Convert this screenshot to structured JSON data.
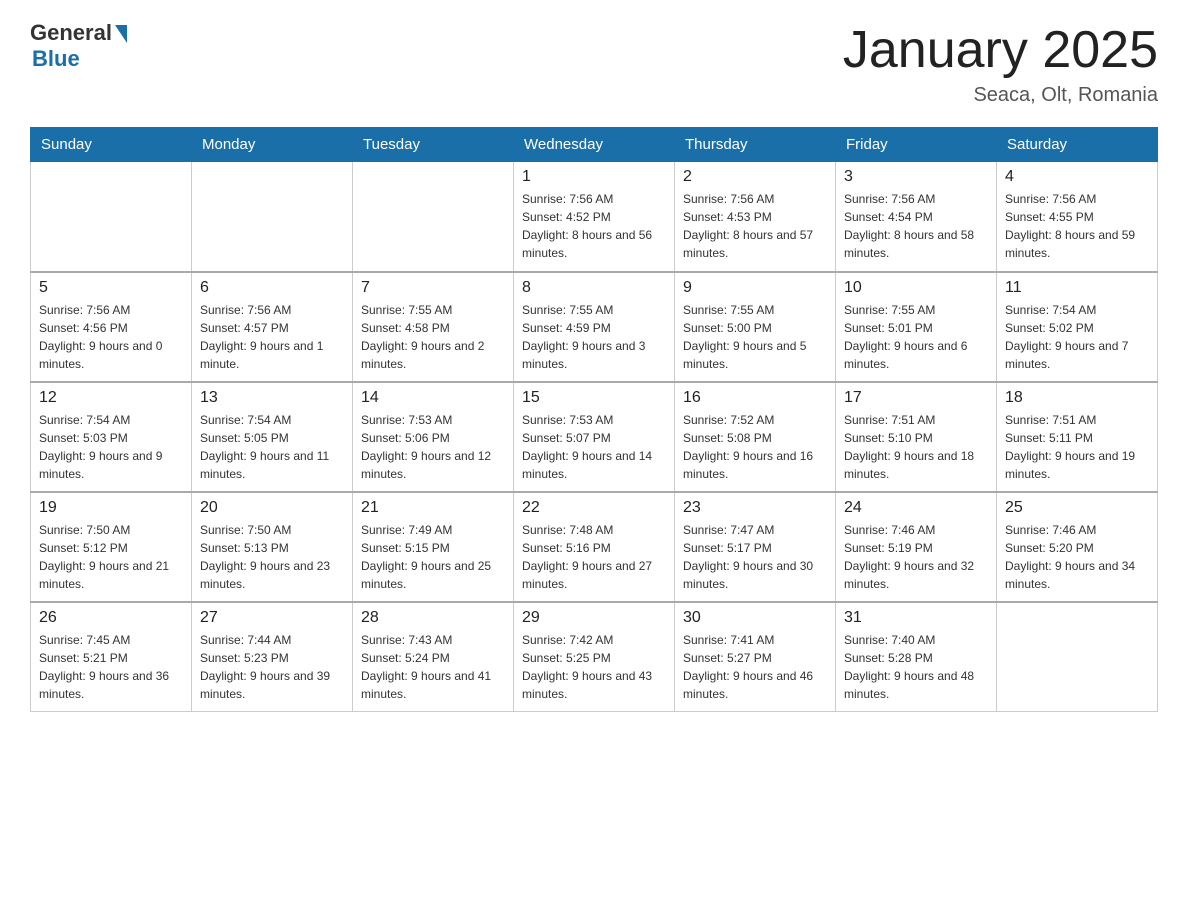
{
  "header": {
    "logo": {
      "general": "General",
      "blue": "Blue"
    },
    "title": "January 2025",
    "location": "Seaca, Olt, Romania"
  },
  "days_of_week": [
    "Sunday",
    "Monday",
    "Tuesday",
    "Wednesday",
    "Thursday",
    "Friday",
    "Saturday"
  ],
  "weeks": [
    [
      {
        "day": "",
        "sunrise": "",
        "sunset": "",
        "daylight": ""
      },
      {
        "day": "",
        "sunrise": "",
        "sunset": "",
        "daylight": ""
      },
      {
        "day": "",
        "sunrise": "",
        "sunset": "",
        "daylight": ""
      },
      {
        "day": "1",
        "sunrise": "Sunrise: 7:56 AM",
        "sunset": "Sunset: 4:52 PM",
        "daylight": "Daylight: 8 hours and 56 minutes."
      },
      {
        "day": "2",
        "sunrise": "Sunrise: 7:56 AM",
        "sunset": "Sunset: 4:53 PM",
        "daylight": "Daylight: 8 hours and 57 minutes."
      },
      {
        "day": "3",
        "sunrise": "Sunrise: 7:56 AM",
        "sunset": "Sunset: 4:54 PM",
        "daylight": "Daylight: 8 hours and 58 minutes."
      },
      {
        "day": "4",
        "sunrise": "Sunrise: 7:56 AM",
        "sunset": "Sunset: 4:55 PM",
        "daylight": "Daylight: 8 hours and 59 minutes."
      }
    ],
    [
      {
        "day": "5",
        "sunrise": "Sunrise: 7:56 AM",
        "sunset": "Sunset: 4:56 PM",
        "daylight": "Daylight: 9 hours and 0 minutes."
      },
      {
        "day": "6",
        "sunrise": "Sunrise: 7:56 AM",
        "sunset": "Sunset: 4:57 PM",
        "daylight": "Daylight: 9 hours and 1 minute."
      },
      {
        "day": "7",
        "sunrise": "Sunrise: 7:55 AM",
        "sunset": "Sunset: 4:58 PM",
        "daylight": "Daylight: 9 hours and 2 minutes."
      },
      {
        "day": "8",
        "sunrise": "Sunrise: 7:55 AM",
        "sunset": "Sunset: 4:59 PM",
        "daylight": "Daylight: 9 hours and 3 minutes."
      },
      {
        "day": "9",
        "sunrise": "Sunrise: 7:55 AM",
        "sunset": "Sunset: 5:00 PM",
        "daylight": "Daylight: 9 hours and 5 minutes."
      },
      {
        "day": "10",
        "sunrise": "Sunrise: 7:55 AM",
        "sunset": "Sunset: 5:01 PM",
        "daylight": "Daylight: 9 hours and 6 minutes."
      },
      {
        "day": "11",
        "sunrise": "Sunrise: 7:54 AM",
        "sunset": "Sunset: 5:02 PM",
        "daylight": "Daylight: 9 hours and 7 minutes."
      }
    ],
    [
      {
        "day": "12",
        "sunrise": "Sunrise: 7:54 AM",
        "sunset": "Sunset: 5:03 PM",
        "daylight": "Daylight: 9 hours and 9 minutes."
      },
      {
        "day": "13",
        "sunrise": "Sunrise: 7:54 AM",
        "sunset": "Sunset: 5:05 PM",
        "daylight": "Daylight: 9 hours and 11 minutes."
      },
      {
        "day": "14",
        "sunrise": "Sunrise: 7:53 AM",
        "sunset": "Sunset: 5:06 PM",
        "daylight": "Daylight: 9 hours and 12 minutes."
      },
      {
        "day": "15",
        "sunrise": "Sunrise: 7:53 AM",
        "sunset": "Sunset: 5:07 PM",
        "daylight": "Daylight: 9 hours and 14 minutes."
      },
      {
        "day": "16",
        "sunrise": "Sunrise: 7:52 AM",
        "sunset": "Sunset: 5:08 PM",
        "daylight": "Daylight: 9 hours and 16 minutes."
      },
      {
        "day": "17",
        "sunrise": "Sunrise: 7:51 AM",
        "sunset": "Sunset: 5:10 PM",
        "daylight": "Daylight: 9 hours and 18 minutes."
      },
      {
        "day": "18",
        "sunrise": "Sunrise: 7:51 AM",
        "sunset": "Sunset: 5:11 PM",
        "daylight": "Daylight: 9 hours and 19 minutes."
      }
    ],
    [
      {
        "day": "19",
        "sunrise": "Sunrise: 7:50 AM",
        "sunset": "Sunset: 5:12 PM",
        "daylight": "Daylight: 9 hours and 21 minutes."
      },
      {
        "day": "20",
        "sunrise": "Sunrise: 7:50 AM",
        "sunset": "Sunset: 5:13 PM",
        "daylight": "Daylight: 9 hours and 23 minutes."
      },
      {
        "day": "21",
        "sunrise": "Sunrise: 7:49 AM",
        "sunset": "Sunset: 5:15 PM",
        "daylight": "Daylight: 9 hours and 25 minutes."
      },
      {
        "day": "22",
        "sunrise": "Sunrise: 7:48 AM",
        "sunset": "Sunset: 5:16 PM",
        "daylight": "Daylight: 9 hours and 27 minutes."
      },
      {
        "day": "23",
        "sunrise": "Sunrise: 7:47 AM",
        "sunset": "Sunset: 5:17 PM",
        "daylight": "Daylight: 9 hours and 30 minutes."
      },
      {
        "day": "24",
        "sunrise": "Sunrise: 7:46 AM",
        "sunset": "Sunset: 5:19 PM",
        "daylight": "Daylight: 9 hours and 32 minutes."
      },
      {
        "day": "25",
        "sunrise": "Sunrise: 7:46 AM",
        "sunset": "Sunset: 5:20 PM",
        "daylight": "Daylight: 9 hours and 34 minutes."
      }
    ],
    [
      {
        "day": "26",
        "sunrise": "Sunrise: 7:45 AM",
        "sunset": "Sunset: 5:21 PM",
        "daylight": "Daylight: 9 hours and 36 minutes."
      },
      {
        "day": "27",
        "sunrise": "Sunrise: 7:44 AM",
        "sunset": "Sunset: 5:23 PM",
        "daylight": "Daylight: 9 hours and 39 minutes."
      },
      {
        "day": "28",
        "sunrise": "Sunrise: 7:43 AM",
        "sunset": "Sunset: 5:24 PM",
        "daylight": "Daylight: 9 hours and 41 minutes."
      },
      {
        "day": "29",
        "sunrise": "Sunrise: 7:42 AM",
        "sunset": "Sunset: 5:25 PM",
        "daylight": "Daylight: 9 hours and 43 minutes."
      },
      {
        "day": "30",
        "sunrise": "Sunrise: 7:41 AM",
        "sunset": "Sunset: 5:27 PM",
        "daylight": "Daylight: 9 hours and 46 minutes."
      },
      {
        "day": "31",
        "sunrise": "Sunrise: 7:40 AM",
        "sunset": "Sunset: 5:28 PM",
        "daylight": "Daylight: 9 hours and 48 minutes."
      },
      {
        "day": "",
        "sunrise": "",
        "sunset": "",
        "daylight": ""
      }
    ]
  ]
}
